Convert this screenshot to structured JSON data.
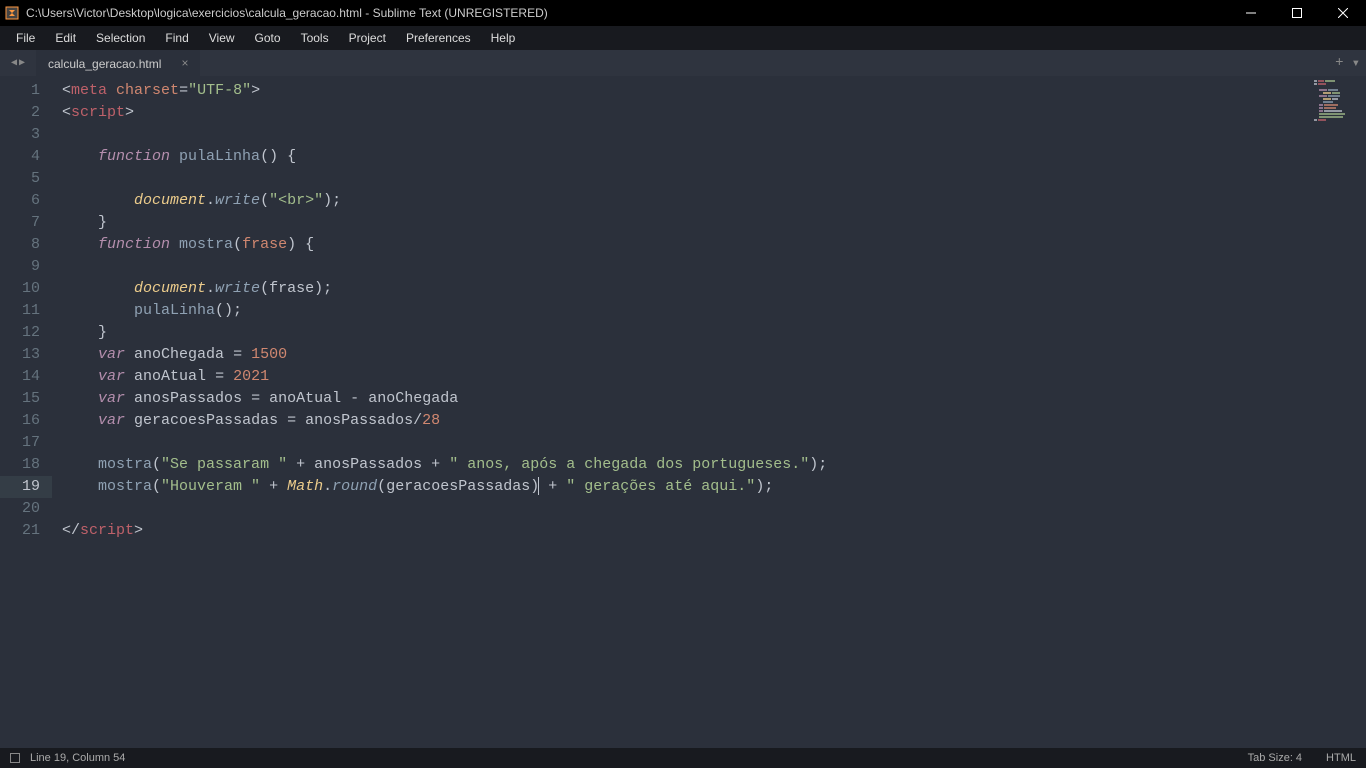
{
  "titlebar": {
    "path": "C:\\Users\\Victor\\Desktop\\logica\\exercicios\\calcula_geracao.html - Sublime Text (UNREGISTERED)"
  },
  "menu": {
    "items": [
      "File",
      "Edit",
      "Selection",
      "Find",
      "View",
      "Goto",
      "Tools",
      "Project",
      "Preferences",
      "Help"
    ]
  },
  "tabs": {
    "active": "calcula_geracao.html"
  },
  "lines": [
    "1",
    "2",
    "3",
    "4",
    "5",
    "6",
    "7",
    "8",
    "9",
    "10",
    "11",
    "12",
    "13",
    "14",
    "15",
    "16",
    "17",
    "18",
    "19",
    "20",
    "21"
  ],
  "code": {
    "l1": {
      "tag_meta": "meta",
      "attr": "charset",
      "val": "\"UTF-8\""
    },
    "l2": {
      "tag_script": "script"
    },
    "l4": {
      "kw": "function",
      "name": "pulaLinha",
      "brace": "{"
    },
    "l6": {
      "obj": "document",
      "method": "write",
      "arg": "\"<br>\""
    },
    "l7": {
      "brace": "}"
    },
    "l8": {
      "kw": "function",
      "name": "mostra",
      "param": "frase",
      "brace": "{"
    },
    "l10": {
      "obj": "document",
      "method": "write",
      "arg": "frase"
    },
    "l11": {
      "call": "pulaLinha"
    },
    "l12": {
      "brace": "}"
    },
    "l13": {
      "kw": "var",
      "name": "anoChegada",
      "val": "1500"
    },
    "l14": {
      "kw": "var",
      "name": "anoAtual",
      "val": "2021"
    },
    "l15": {
      "kw": "var",
      "name": "anosPassados",
      "rhs_a": "anoAtual",
      "rhs_b": "anoChegada"
    },
    "l16": {
      "kw": "var",
      "name": "geracoesPassadas",
      "rhs_a": "anosPassados",
      "rhs_b": "28"
    },
    "l18": {
      "fn": "mostra",
      "s1": "\"Se passaram \"",
      "v1": "anosPassados",
      "s2": "\" anos, após a chegada dos portugueses.\""
    },
    "l19": {
      "fn": "mostra",
      "s1": "\"Houveram \"",
      "obj": "Math",
      "method": "round",
      "arg": "geracoesPassadas",
      "s2": "\" gerações até aqui.\""
    },
    "l21": {
      "tag_script": "script"
    }
  },
  "status": {
    "pos": "Line 19, Column 54",
    "tabsize": "Tab Size: 4",
    "lang": "HTML"
  }
}
